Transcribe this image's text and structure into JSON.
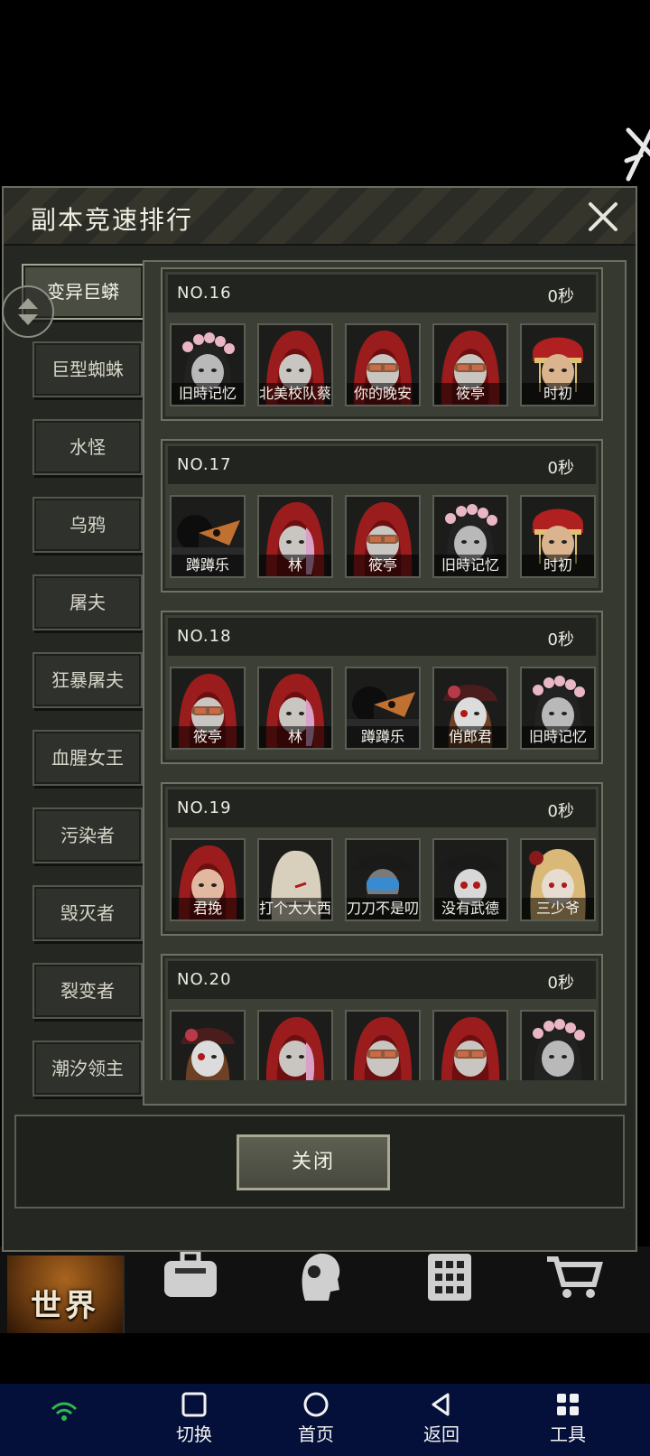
{
  "dialog": {
    "title": "副本竞速排行",
    "close_label": "关闭"
  },
  "categories": [
    {
      "label": "变异巨蟒",
      "active": true
    },
    {
      "label": "巨型蜘蛛"
    },
    {
      "label": "水怪"
    },
    {
      "label": "乌鸦"
    },
    {
      "label": "屠夫"
    },
    {
      "label": "狂暴屠夫"
    },
    {
      "label": "血腥女王"
    },
    {
      "label": "污染者"
    },
    {
      "label": "毁灭者"
    },
    {
      "label": "裂变者"
    },
    {
      "label": "潮汐领主"
    }
  ],
  "rankings": [
    {
      "rank": "NO.16",
      "time": "0秒",
      "players": [
        {
          "name": "旧時记忆",
          "avatar": "flower-crown"
        },
        {
          "name": "北美校队蔡",
          "avatar": "red-hood"
        },
        {
          "name": "你的晚安",
          "avatar": "red-hood-goggles"
        },
        {
          "name": "筱亭",
          "avatar": "red-hood-goggles"
        },
        {
          "name": "时初",
          "avatar": "red-headdress"
        }
      ]
    },
    {
      "rank": "NO.17",
      "time": "0秒",
      "players": [
        {
          "name": "蹲蹲乐",
          "avatar": "plague-mask"
        },
        {
          "name": "林",
          "avatar": "red-hood-pink"
        },
        {
          "name": "筱亭",
          "avatar": "red-hood-goggles"
        },
        {
          "name": "旧時记忆",
          "avatar": "flower-crown"
        },
        {
          "name": "时初",
          "avatar": "red-headdress"
        }
      ]
    },
    {
      "rank": "NO.18",
      "time": "0秒",
      "players": [
        {
          "name": "筱亭",
          "avatar": "red-hood-goggles"
        },
        {
          "name": "林",
          "avatar": "red-hood-pink"
        },
        {
          "name": "蹲蹲乐",
          "avatar": "plague-mask"
        },
        {
          "name": "俏郎君",
          "avatar": "rose-hat"
        },
        {
          "name": "旧時记忆",
          "avatar": "flower-crown"
        }
      ]
    },
    {
      "rank": "NO.19",
      "time": "0秒",
      "players": [
        {
          "name": "君挽",
          "avatar": "red-hood-girl"
        },
        {
          "name": "打个大大西",
          "avatar": "bag-mask"
        },
        {
          "name": "刀刀不是叨叨",
          "avatar": "pirate-goggles"
        },
        {
          "name": "没有武德",
          "avatar": "pirate-mask"
        },
        {
          "name": "三少爷",
          "avatar": "blonde-rose"
        }
      ]
    },
    {
      "rank": "NO.20",
      "time": "0秒",
      "players": [
        {
          "name": "",
          "avatar": "rose-hat"
        },
        {
          "name": "",
          "avatar": "red-hood-pink"
        },
        {
          "name": "",
          "avatar": "red-hood-goggles"
        },
        {
          "name": "",
          "avatar": "red-hood-goggles"
        },
        {
          "name": "",
          "avatar": "flower-crown"
        }
      ]
    }
  ],
  "game_nav": {
    "world_label": "世界",
    "icons": [
      "backpack-icon",
      "character-icon",
      "building-icon",
      "shop-cart-icon"
    ]
  },
  "system_nav": [
    {
      "label": "切换",
      "icon": "square-icon"
    },
    {
      "label": "首页",
      "icon": "circle-icon"
    },
    {
      "label": "返回",
      "icon": "back-triangle-icon"
    },
    {
      "label": "工具",
      "icon": "grid-icon"
    }
  ],
  "colors": {
    "red_hood": "#9b1c1c",
    "panel": "#353930",
    "nav_bar": "#04103a",
    "wifi": "#2fb84a"
  }
}
